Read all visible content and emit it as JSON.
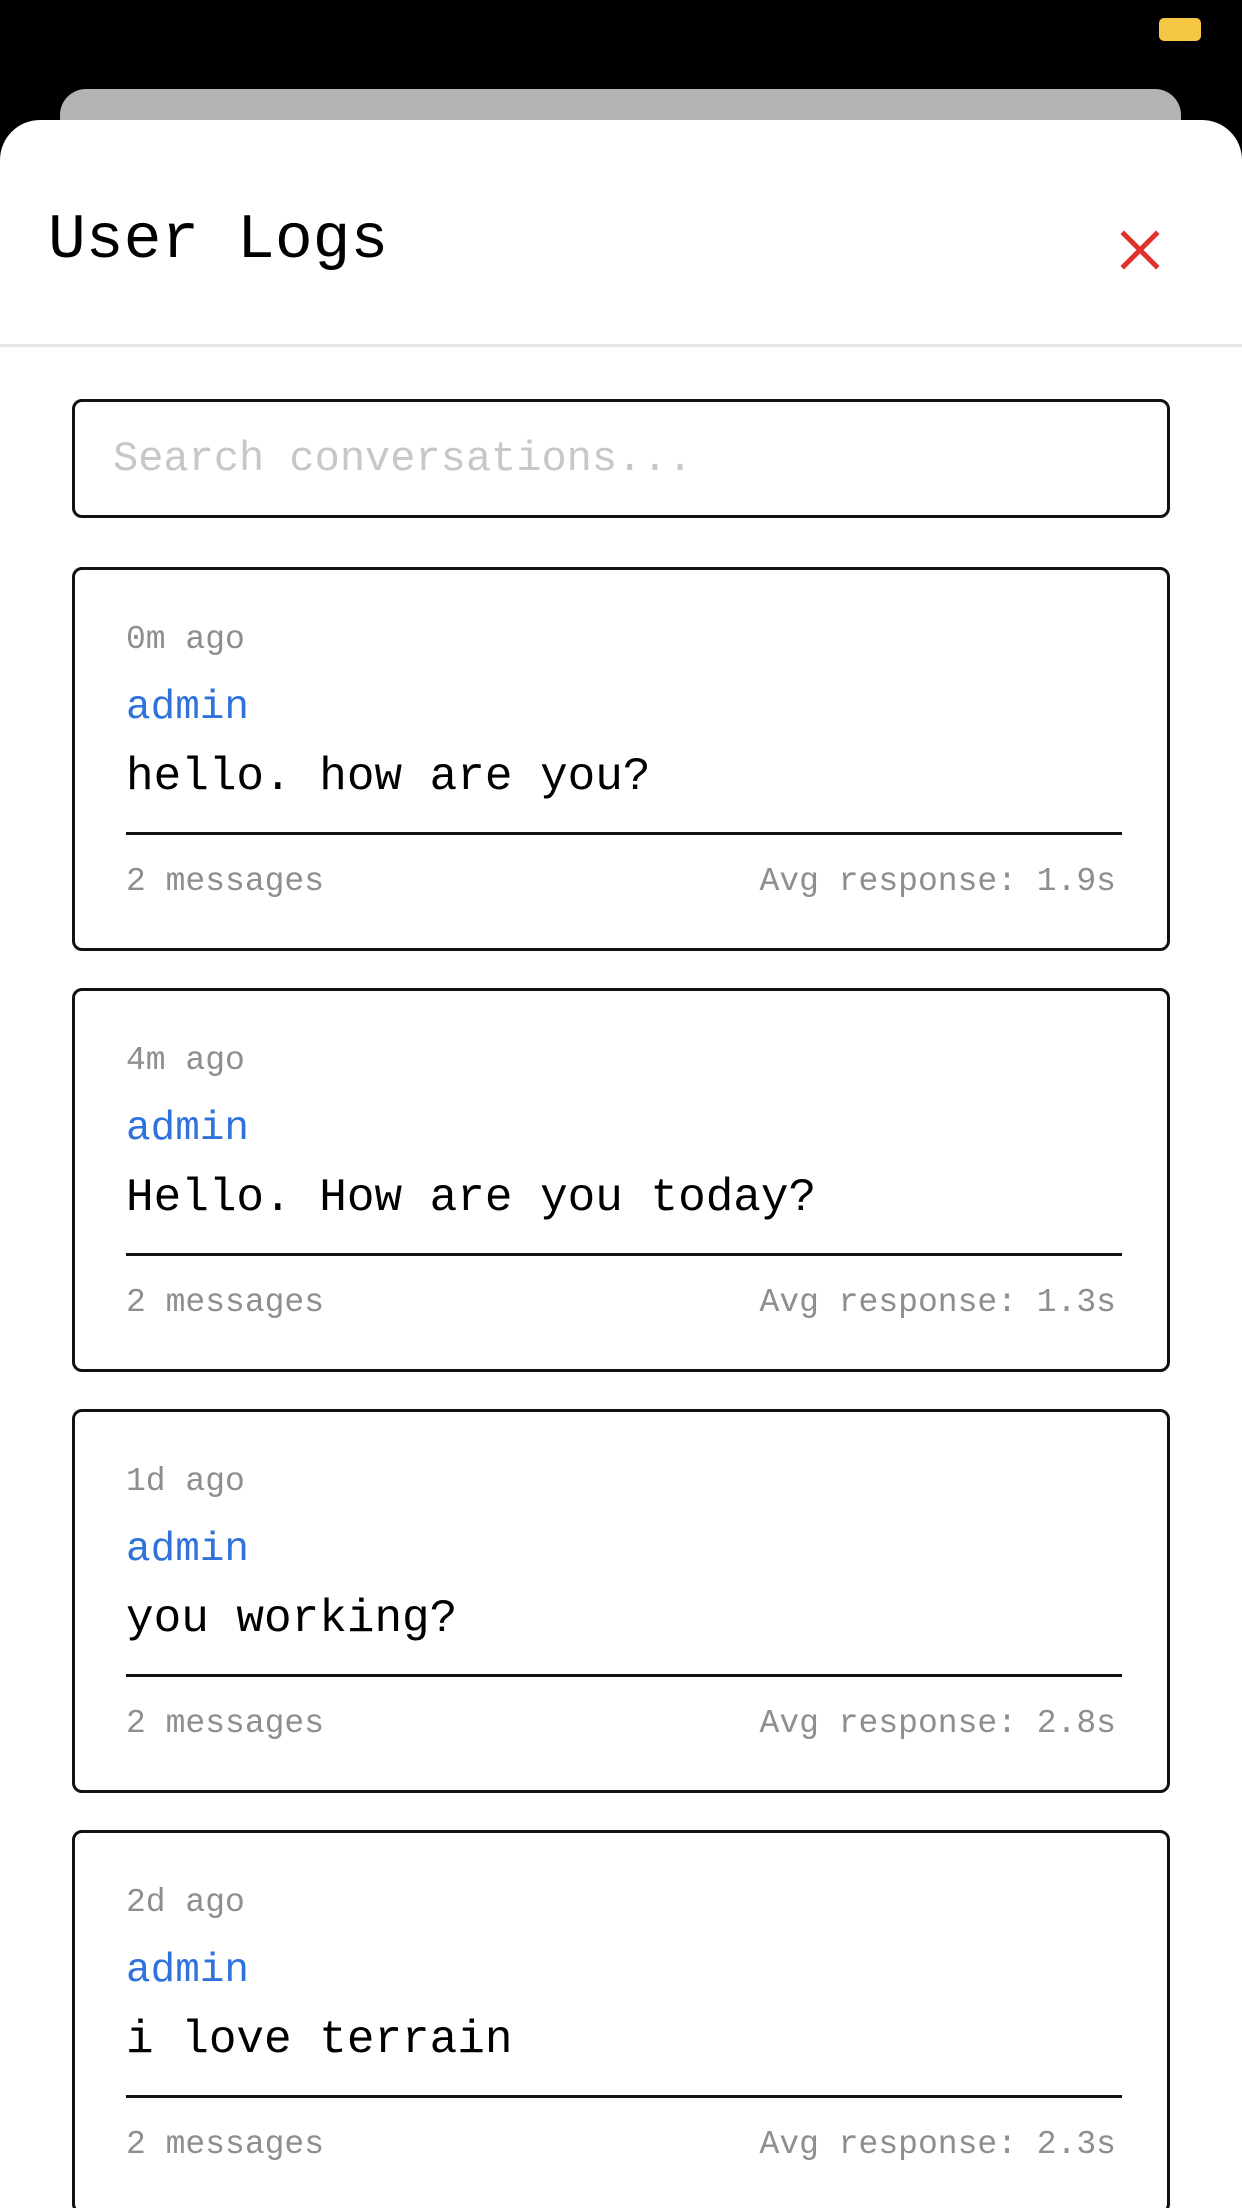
{
  "header": {
    "title": "User Logs",
    "close_icon": "close-icon",
    "close_color": "#e0302a"
  },
  "search": {
    "placeholder": "Search conversations...",
    "value": ""
  },
  "logs": [
    {
      "time": "0m ago",
      "user": "admin",
      "message": "hello. how are you?",
      "count": "2 messages",
      "avg": "Avg response: 1.9s"
    },
    {
      "time": "4m ago",
      "user": "admin",
      "message": "Hello. How are you today?",
      "count": "2 messages",
      "avg": "Avg response: 1.3s"
    },
    {
      "time": "1d ago",
      "user": "admin",
      "message": "you working?",
      "count": "2 messages",
      "avg": "Avg response: 2.8s"
    },
    {
      "time": "2d ago",
      "user": "admin",
      "message": "i love terrain",
      "count": "2 messages",
      "avg": "Avg response: 2.3s"
    }
  ],
  "colors": {
    "accent_user": "#2f72dc",
    "muted_text": "#8e8e8e",
    "battery": "#f5c744"
  }
}
